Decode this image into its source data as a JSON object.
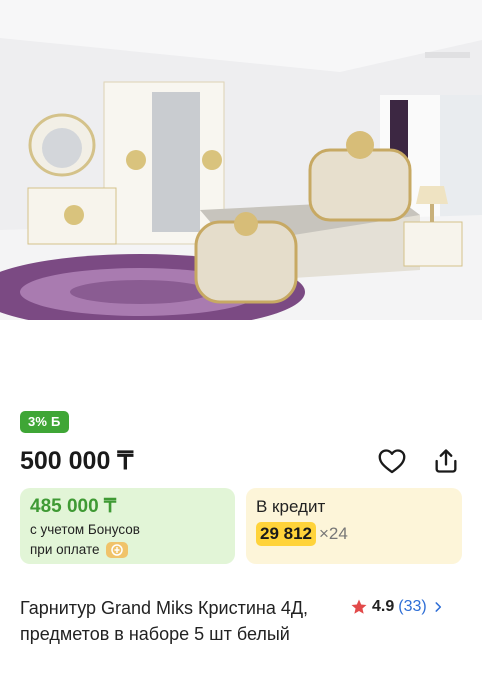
{
  "product": {
    "image_alt": "Спальный гарнитур",
    "bonus_badge": "3% Б",
    "price": "500 000 ₸",
    "bonus_card": {
      "price": "485 000 ₸",
      "note_line1": "с учетом Бонусов",
      "note_line2": "при оплате"
    },
    "credit_card": {
      "title": "В кредит",
      "amount": "29 812",
      "multiplier": "×24"
    },
    "title": "Гарнитур Grand Miks Кристина 4Д, предметов в наборе 5 шт белый",
    "rating": {
      "score": "4.9",
      "count": "(33)"
    }
  },
  "icons": {
    "favorite": "heart-icon",
    "share": "share-icon",
    "rating": "star-icon",
    "chevron": "chevron-right-icon",
    "coin": "bonus-coin-icon"
  },
  "colors": {
    "bonus_green": "#3fa636",
    "bonus_card_bg": "#e2f5d7",
    "credit_card_bg": "#fdf5d9",
    "credit_highlight": "#ffd33a",
    "rating_star": "#e24a4a",
    "link_blue": "#2e6ed6"
  }
}
